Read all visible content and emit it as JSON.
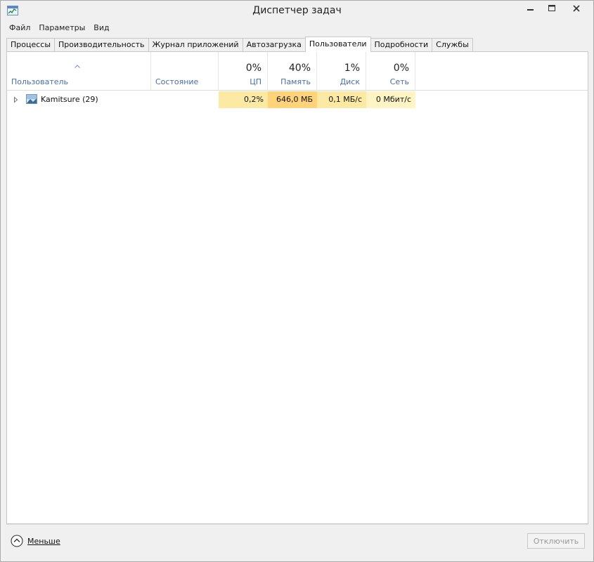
{
  "window": {
    "title": "Диспетчер задач"
  },
  "menu": [
    "Файл",
    "Параметры",
    "Вид"
  ],
  "tabs": [
    {
      "label": "Процессы",
      "active": false
    },
    {
      "label": "Производительность",
      "active": false
    },
    {
      "label": "Журнал приложений",
      "active": false
    },
    {
      "label": "Автозагрузка",
      "active": false
    },
    {
      "label": "Пользователи",
      "active": true
    },
    {
      "label": "Подробности",
      "active": false
    },
    {
      "label": "Службы",
      "active": false
    }
  ],
  "columns": {
    "user": {
      "name": "Пользователь"
    },
    "status": {
      "name": "Состояние"
    },
    "cpu": {
      "pct": "0%",
      "name": "ЦП"
    },
    "memory": {
      "pct": "40%",
      "name": "Память"
    },
    "disk": {
      "pct": "1%",
      "name": "Диск"
    },
    "network": {
      "pct": "0%",
      "name": "Сеть"
    }
  },
  "users": [
    {
      "name": "Kamitsure (29)",
      "status": "",
      "cpu": "0,2%",
      "memory": "646,0 МБ",
      "disk": "0,1 МБ/с",
      "network": "0 Мбит/с"
    }
  ],
  "footer": {
    "less_label": "Меньше",
    "disconnect_label": "Отключить"
  },
  "colors": {
    "heat_low": "#fff4c4",
    "heat_mid": "#fce9a4",
    "heat_high": "#ffd37a",
    "header_text": "#4a6ea8"
  }
}
